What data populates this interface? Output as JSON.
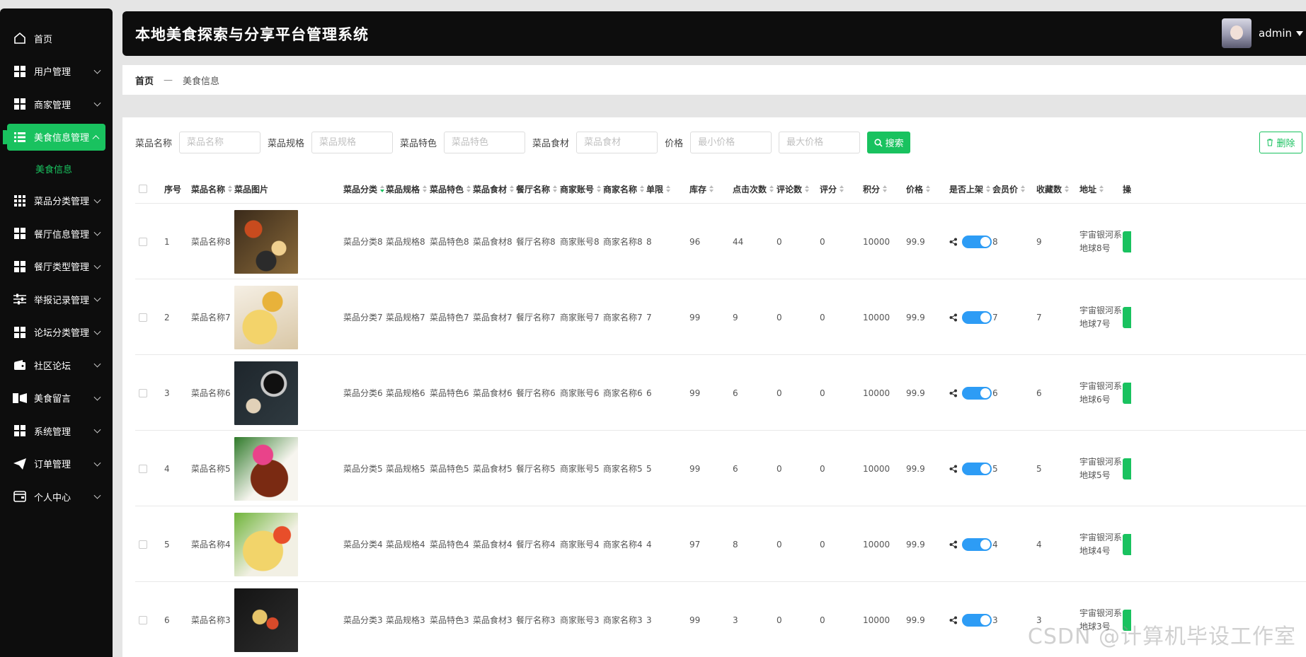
{
  "app": {
    "title": "本地美食探索与分享平台管理系统"
  },
  "user": {
    "name": "admin"
  },
  "sidebar": {
    "items": [
      {
        "label": "首页",
        "icon": "home-icon"
      },
      {
        "label": "用户管理",
        "icon": "grid-icon"
      },
      {
        "label": "商家管理",
        "icon": "grid-icon"
      },
      {
        "label": "美食信息管理",
        "icon": "list-icon"
      },
      {
        "label": "美食信息",
        "icon": ""
      },
      {
        "label": "菜品分类管理",
        "icon": "table-icon"
      },
      {
        "label": "餐厅信息管理",
        "icon": "grid-icon"
      },
      {
        "label": "餐厅类型管理",
        "icon": "grid-icon"
      },
      {
        "label": "举报记录管理",
        "icon": "sliders-icon"
      },
      {
        "label": "论坛分类管理",
        "icon": "grid-icon"
      },
      {
        "label": "社区论坛",
        "icon": "wallet-icon"
      },
      {
        "label": "美食留言",
        "icon": "film-icon"
      },
      {
        "label": "系统管理",
        "icon": "grid-icon"
      },
      {
        "label": "订单管理",
        "icon": "send-icon"
      },
      {
        "label": "个人中心",
        "icon": "card-icon"
      }
    ]
  },
  "breadcrumb": {
    "home": "首页",
    "sep": "—",
    "current": "美食信息"
  },
  "search": {
    "name_label": "菜品名称",
    "name_placeholder": "菜品名称",
    "spec_label": "菜品规格",
    "spec_placeholder": "菜品规格",
    "feature_label": "菜品特色",
    "feature_placeholder": "菜品特色",
    "ingredient_label": "菜品食材",
    "ingredient_placeholder": "菜品食材",
    "price_label": "价格",
    "min_placeholder": "最小价格",
    "max_placeholder": "最大价格",
    "button": "搜索"
  },
  "delete_button": "删除",
  "table": {
    "headers": [
      "序号",
      "菜品名称",
      "菜品图片",
      "菜品分类",
      "菜品规格",
      "菜品特色",
      "菜品食材",
      "餐厅名称",
      "商家账号",
      "商家名称",
      "单限",
      "库存",
      "点击次数",
      "评论数",
      "评分",
      "积分",
      "价格",
      "是否上架",
      "会员价",
      "收藏数",
      "地址",
      "操"
    ],
    "rows": [
      {
        "idx": "1",
        "name": "菜品名称8",
        "cat": "菜品分类8",
        "spec": "菜品规格8",
        "feature": "菜品特色8",
        "ingredient": "菜品食材8",
        "rest": "餐厅名称8",
        "acct": "商家账号8",
        "merchant": "商家名称8",
        "limit": "8",
        "stock": "96",
        "clicks": "44",
        "comments": "0",
        "score": "0",
        "points": "10000",
        "price": "99.9",
        "vip": "8",
        "fav": "9",
        "addr": "宇宙银河系地球8号"
      },
      {
        "idx": "2",
        "name": "菜品名称7",
        "cat": "菜品分类7",
        "spec": "菜品规格7",
        "feature": "菜品特色7",
        "ingredient": "菜品食材7",
        "rest": "餐厅名称7",
        "acct": "商家账号7",
        "merchant": "商家名称7",
        "limit": "7",
        "stock": "99",
        "clicks": "9",
        "comments": "0",
        "score": "0",
        "points": "10000",
        "price": "99.9",
        "vip": "7",
        "fav": "7",
        "addr": "宇宙银河系地球7号"
      },
      {
        "idx": "3",
        "name": "菜品名称6",
        "cat": "菜品分类6",
        "spec": "菜品规格6",
        "feature": "菜品特色6",
        "ingredient": "菜品食材6",
        "rest": "餐厅名称6",
        "acct": "商家账号6",
        "merchant": "商家名称6",
        "limit": "6",
        "stock": "99",
        "clicks": "6",
        "comments": "0",
        "score": "0",
        "points": "10000",
        "price": "99.9",
        "vip": "6",
        "fav": "6",
        "addr": "宇宙银河系地球6号"
      },
      {
        "idx": "4",
        "name": "菜品名称5",
        "cat": "菜品分类5",
        "spec": "菜品规格5",
        "feature": "菜品特色5",
        "ingredient": "菜品食材5",
        "rest": "餐厅名称5",
        "acct": "商家账号5",
        "merchant": "商家名称5",
        "limit": "5",
        "stock": "99",
        "clicks": "6",
        "comments": "0",
        "score": "0",
        "points": "10000",
        "price": "99.9",
        "vip": "5",
        "fav": "5",
        "addr": "宇宙银河系地球5号"
      },
      {
        "idx": "5",
        "name": "菜品名称4",
        "cat": "菜品分类4",
        "spec": "菜品规格4",
        "feature": "菜品特色4",
        "ingredient": "菜品食材4",
        "rest": "餐厅名称4",
        "acct": "商家账号4",
        "merchant": "商家名称4",
        "limit": "4",
        "stock": "97",
        "clicks": "8",
        "comments": "0",
        "score": "0",
        "points": "10000",
        "price": "99.9",
        "vip": "4",
        "fav": "4",
        "addr": "宇宙银河系地球4号"
      },
      {
        "idx": "6",
        "name": "菜品名称3",
        "cat": "菜品分类3",
        "spec": "菜品规格3",
        "feature": "菜品特色3",
        "ingredient": "菜品食材3",
        "rest": "餐厅名称3",
        "acct": "商家账号3",
        "merchant": "商家名称3",
        "limit": "3",
        "stock": "99",
        "clicks": "3",
        "comments": "0",
        "score": "0",
        "points": "10000",
        "price": "99.9",
        "vip": "3",
        "fav": "3",
        "addr": "宇宙银河系地球3号"
      }
    ]
  },
  "watermark": "CSDN @计算机毕设工作室",
  "colors": {
    "accent": "#19c25f",
    "toggle": "#2d9cf5",
    "dark": "#0d0d0d"
  }
}
